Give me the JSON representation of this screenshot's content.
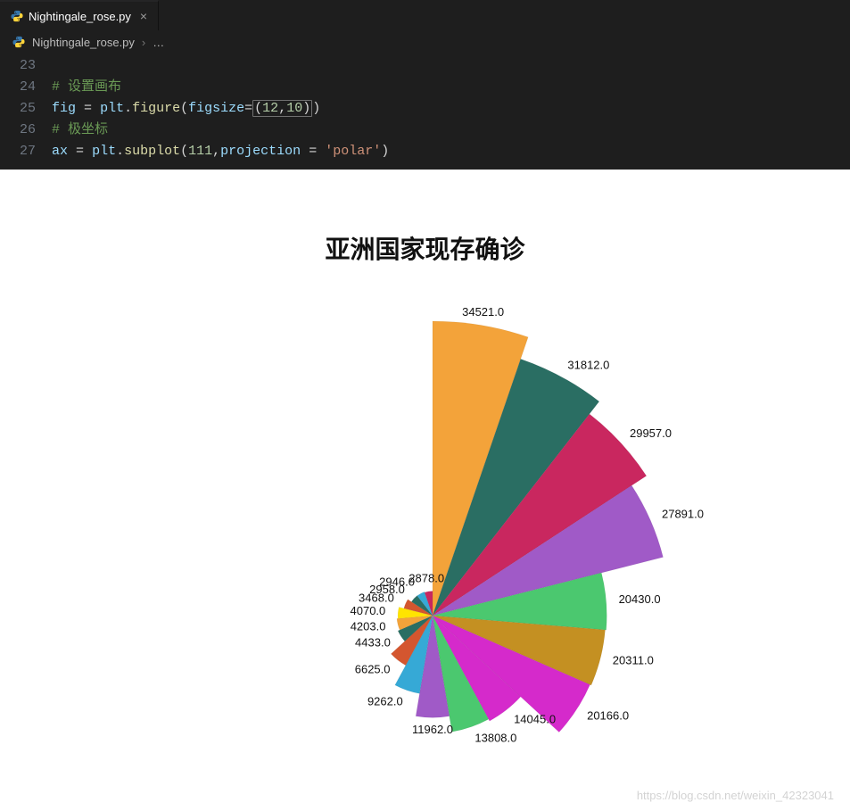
{
  "tab": {
    "filename": "Nightingale_rose.py",
    "close_glyph": "×"
  },
  "breadcrumb": {
    "filename": "Nightingale_rose.py",
    "sep": "›",
    "more": "…"
  },
  "code": {
    "lines": [
      {
        "n": "23",
        "html": ""
      },
      {
        "n": "24",
        "html": "<span class='tok-comment'># 设置画布</span>"
      },
      {
        "n": "25",
        "html": "<span class='tok-ident'>fig</span> <span class='tok-op'>=</span> <span class='tok-ident'>plt</span><span class='tok-op'>.</span><span class='tok-func'>figure</span><span class='tok-paren'>(</span><span class='tok-param'>figsize</span><span class='tok-op'>=</span><span class='cursor-box'><span class='tok-paren'>(</span><span class='tok-num'>12</span><span class='tok-op'>,</span><span class='tok-num'>10</span><span class='tok-paren'>)</span></span><span class='tok-paren'>)</span>"
      },
      {
        "n": "26",
        "html": "<span class='tok-comment'># 极坐标</span>"
      },
      {
        "n": "27",
        "html": "<span class='tok-ident'>ax</span> <span class='tok-op'>=</span> <span class='tok-ident'>plt</span><span class='tok-op'>.</span><span class='tok-func'>subplot</span><span class='tok-paren'>(</span><span class='tok-num'>111</span><span class='tok-op'>,</span><span class='tok-param'>projection</span> <span class='tok-op'>=</span> <span class='tok-str'>'polar'</span><span class='tok-paren'>)</span>"
      }
    ]
  },
  "watermark": "https://blog.csdn.net/weixin_42323041",
  "chart_data": {
    "type": "polar-bar",
    "title": "亚洲国家现存确诊",
    "start_angle_deg": 90,
    "direction": "clockwise",
    "series": [
      {
        "label": "34521.0",
        "value": 34521.0,
        "color": "#f3a33a"
      },
      {
        "label": "31812.0",
        "value": 31812.0,
        "color": "#2a6e63"
      },
      {
        "label": "29957.0",
        "value": 29957.0,
        "color": "#c9275f"
      },
      {
        "label": "27891.0",
        "value": 27891.0,
        "color": "#a05ac7"
      },
      {
        "label": "20430.0",
        "value": 20430.0,
        "color": "#4bc86f"
      },
      {
        "label": "20311.0",
        "value": 20311.0,
        "color": "#c49022"
      },
      {
        "label": "20166.0",
        "value": 20166.0,
        "color": "#d52acb"
      },
      {
        "label": "14045.0",
        "value": 14045.0,
        "color": "#d52acb"
      },
      {
        "label": "13808.0",
        "value": 13808.0,
        "color": "#4bc86f"
      },
      {
        "label": "11962.0",
        "value": 11962.0,
        "color": "#a05ac7"
      },
      {
        "label": "9262.0",
        "value": 9262.0,
        "color": "#36a9d6"
      },
      {
        "label": "6625.0",
        "value": 6625.0,
        "color": "#d4562f"
      },
      {
        "label": "4433.0",
        "value": 4433.0,
        "color": "#2a6e63"
      },
      {
        "label": "4203.0",
        "value": 4203.0,
        "color": "#f3a33a"
      },
      {
        "label": "4070.0",
        "value": 4070.0,
        "color": "#ffe400"
      },
      {
        "label": "3468.0",
        "value": 3468.0,
        "color": "#d4562f"
      },
      {
        "label": "2958.0",
        "value": 2958.0,
        "color": "#2a6e63"
      },
      {
        "label": "2946.0",
        "value": 2946.0,
        "color": "#36a9d6"
      },
      {
        "label": "2878.0",
        "value": 2878.0,
        "color": "#c9275f"
      }
    ]
  }
}
